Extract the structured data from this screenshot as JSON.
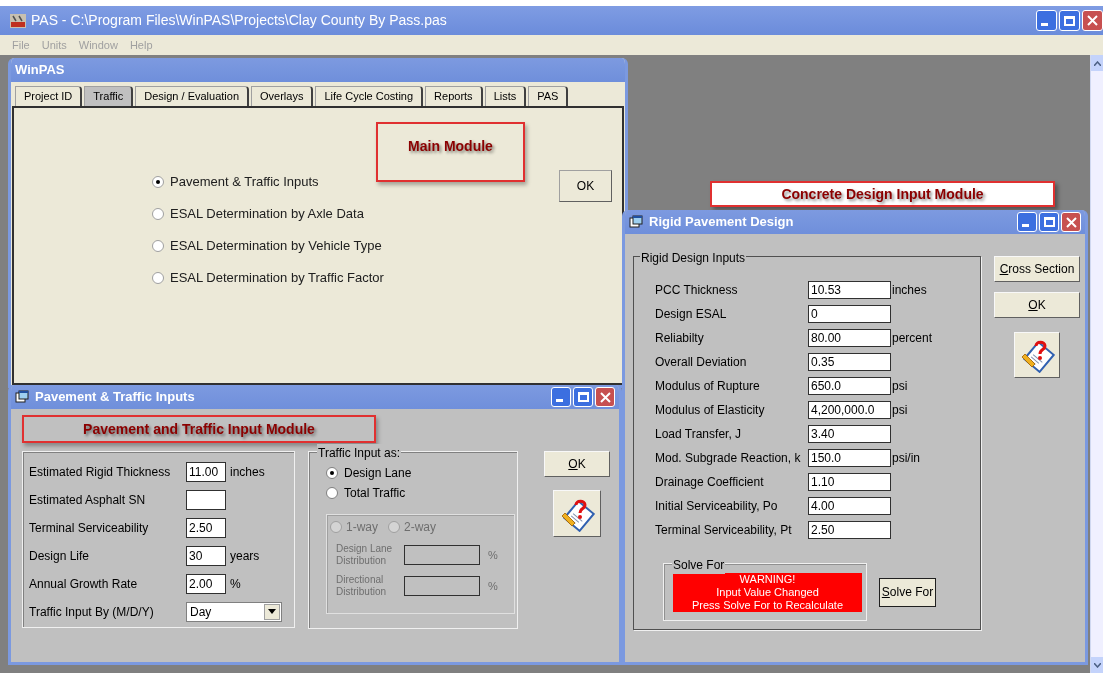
{
  "app": {
    "title": "PAS - C:\\Program Files\\WinPAS\\Projects\\Clay County By Pass.pas",
    "menu": [
      "File",
      "Units",
      "Window",
      "Help"
    ]
  },
  "main_window": {
    "title": "WinPAS",
    "tabs": [
      {
        "label": "Project ID",
        "selected": false
      },
      {
        "label": "Traffic",
        "selected": true
      },
      {
        "label": "Design / Evaluation",
        "selected": false
      },
      {
        "label": "Overlays",
        "selected": false
      },
      {
        "label": "Life Cycle Costing",
        "selected": false
      },
      {
        "label": "Reports",
        "selected": false
      },
      {
        "label": "Lists",
        "selected": false
      },
      {
        "label": "PAS",
        "selected": false
      }
    ],
    "annotation": "Main Module",
    "options": [
      {
        "label": "Pavement & Traffic Inputs",
        "selected": true
      },
      {
        "label": "ESAL Determination by Axle Data",
        "selected": false
      },
      {
        "label": "ESAL Determination by Vehicle Type",
        "selected": false
      },
      {
        "label": "ESAL Determination by Traffic Factor",
        "selected": false
      }
    ],
    "ok_button": {
      "label": "OK",
      "access_key": false
    }
  },
  "traffic_window": {
    "title": "Pavement & Traffic Inputs",
    "annotation": "Pavement and Traffic Input Module",
    "fields": [
      {
        "kind": "text",
        "label": "Estimated Rigid Thickness",
        "value": "11.00",
        "unit": "inches"
      },
      {
        "kind": "text",
        "label": "Estimated Asphalt SN"
      },
      {
        "kind": "text",
        "label": "Terminal Serviceability",
        "value": "2.50"
      },
      {
        "kind": "text",
        "label": "Design Life",
        "value": "30",
        "unit": "years"
      },
      {
        "kind": "text",
        "label": "Annual Growth Rate",
        "value": "2.00",
        "unit": "%"
      },
      {
        "kind": "dropdown",
        "label": "Traffic Input By (M/D/Y)",
        "value": "Day"
      }
    ],
    "traffic_input": {
      "title": "Traffic Input as:",
      "options": [
        {
          "label": "Design Lane",
          "selected": true
        },
        {
          "label": "Total Traffic",
          "selected": false
        }
      ],
      "split": {
        "disabled": true,
        "options": [
          {
            "label": "1-way",
            "selected": false
          },
          {
            "label": "2-way",
            "selected": false
          }
        ],
        "distributions": [
          {
            "label": "Design Lane Distribution",
            "unit": "%"
          },
          {
            "label": "Directional Distribution",
            "unit": "%"
          }
        ]
      }
    },
    "ok_button": {
      "label": "OK",
      "access_key": true
    }
  },
  "concrete_annotation": "Concrete Design Input Module",
  "rigid_window": {
    "title": "Rigid Pavement Design",
    "group_title": "Rigid Design Inputs",
    "fields": [
      {
        "label": "PCC Thickness",
        "value": "10.53",
        "unit": "inches"
      },
      {
        "label": "Design ESAL",
        "value": "0"
      },
      {
        "label": "Reliabilty",
        "value": "80.00",
        "unit": "percent"
      },
      {
        "label": "Overall Deviation",
        "value": "0.35"
      },
      {
        "label": "Modulus of Rupture",
        "value": "650.0",
        "unit": "psi"
      },
      {
        "label": "Modulus of Elasticity",
        "value": "4,200,000.0",
        "unit": "psi"
      },
      {
        "label": "Load Transfer, J",
        "value": "3.40"
      },
      {
        "label": "Mod. Subgrade Reaction, k",
        "value": "150.0",
        "unit": "psi/in"
      },
      {
        "label": "Drainage Coefficient",
        "value": "1.10"
      },
      {
        "label": "Initial Serviceability, Po",
        "value": "4.00"
      },
      {
        "label": "Terminal Serviceability, Pt",
        "value": "2.50"
      }
    ],
    "solve_group": {
      "title": "Solve For",
      "warning": [
        "WARNING!",
        "Input Value Changed",
        "Press Solve For to Recalculate"
      ]
    },
    "solve_button": {
      "label": "Solve For",
      "access_key": true
    },
    "buttons": [
      {
        "label": "Cross Section",
        "access_key": true
      },
      {
        "label": "OK",
        "access_key": true
      }
    ]
  }
}
